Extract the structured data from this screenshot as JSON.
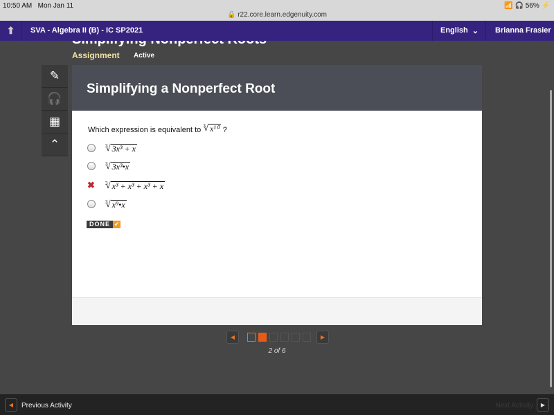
{
  "status": {
    "time": "10:50 AM",
    "date": "Mon Jan 11",
    "url": "r22.core.learn.edgenuity.com",
    "battery": "56%"
  },
  "nav": {
    "course": "SVA - Algebra II (B) - IC SP2021",
    "language": "English",
    "user": "Brianna Frasier"
  },
  "lesson": {
    "title": "Simplifying Nonperfect Roots",
    "type": "Assignment",
    "state": "Active"
  },
  "card": {
    "title": "Simplifying a Nonperfect Root",
    "question": "Which expression is equivalent to",
    "question_index": "3",
    "question_radicand": "x¹⁰",
    "question_end": "?",
    "options": [
      {
        "index": "3",
        "radicand": "3x³ + x",
        "state": "unselected"
      },
      {
        "index": "3",
        "radicand": "3x³•x",
        "state": "unselected"
      },
      {
        "index": "3",
        "radicand": "x³ + x³ + x³ + x",
        "state": "incorrect"
      },
      {
        "index": "3",
        "radicand": "x⁹•x",
        "state": "unselected"
      }
    ],
    "done_label": "DONE"
  },
  "pager": {
    "current": 2,
    "total": 6,
    "label": "2 of 6"
  },
  "footer": {
    "previous": "Previous Activity",
    "next": "Next Activity"
  },
  "colors": {
    "nav": "#35237f",
    "accent": "#ea5a16",
    "incorrect": "#c0282d"
  }
}
